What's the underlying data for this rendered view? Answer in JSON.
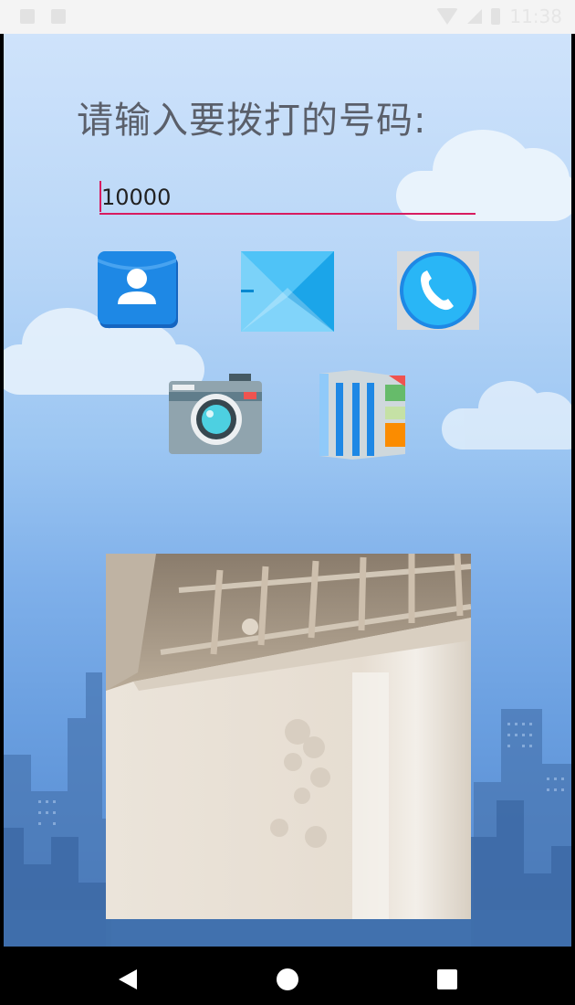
{
  "status_bar": {
    "time": "11:38"
  },
  "main": {
    "prompt": "请输入要拨打的号码:",
    "phone_input": {
      "value": "10000"
    },
    "icons": [
      "contacts-icon",
      "sms-icon",
      "phone-call-icon",
      "camera-icon",
      "gallery-icon"
    ]
  },
  "colors": {
    "accent": "#d81b60",
    "prompt_text": "#5a5f6a",
    "sky_top": "#cfe3fb",
    "sky_bottom": "#4f82c8"
  }
}
